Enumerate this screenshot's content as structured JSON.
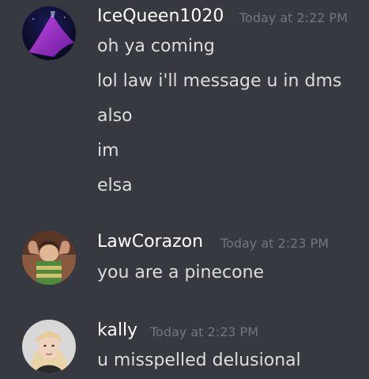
{
  "messages": [
    {
      "username": "IceQueen1020",
      "timestamp": "Today at 2:22 PM",
      "lines": [
        "oh ya coming",
        "lol law i'll message u in dms",
        "also",
        "im",
        "elsa"
      ]
    },
    {
      "username": "LawCorazon",
      "timestamp": "Today at 2:23 PM",
      "lines": [
        "you are a pinecone"
      ]
    },
    {
      "username": "kally",
      "timestamp": "Today at 2:23 PM",
      "lines": [
        "u misspelled delusional"
      ]
    }
  ]
}
